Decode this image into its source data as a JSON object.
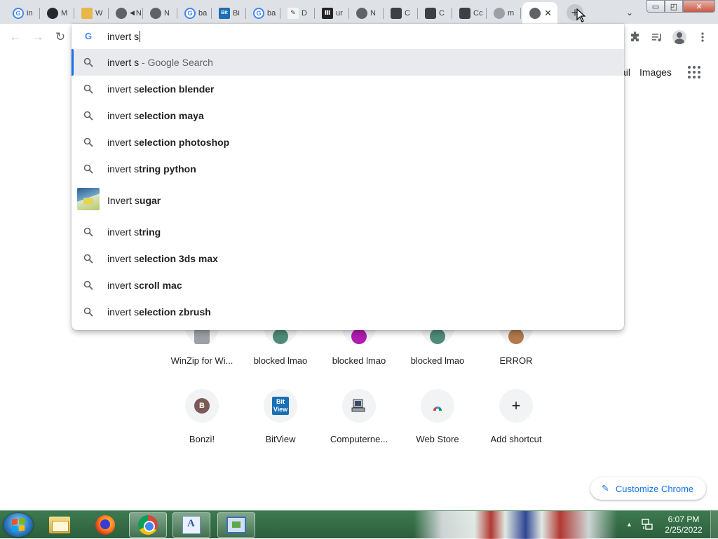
{
  "tabs": [
    {
      "favicon": "google-icon",
      "title": "in"
    },
    {
      "favicon": "github-icon",
      "title": "M"
    },
    {
      "favicon": "wiki-icon",
      "title": "W"
    },
    {
      "favicon": "speaker-icon",
      "title": "N"
    },
    {
      "favicon": "globe-icon",
      "title": "N"
    },
    {
      "favicon": "google-icon",
      "title": "ba"
    },
    {
      "favicon": "bitview-icon",
      "title": "Bi"
    },
    {
      "favicon": "google-icon",
      "title": "ba"
    },
    {
      "favicon": "deviantart-icon",
      "title": "D"
    },
    {
      "favicon": "library-icon",
      "title": "ur"
    },
    {
      "favicon": "globe-icon",
      "title": "N"
    },
    {
      "favicon": "cube-icon",
      "title": "C"
    },
    {
      "favicon": "cube-icon",
      "title": "C"
    },
    {
      "favicon": "cube-icon",
      "title": "Cc"
    },
    {
      "favicon": "globe-icon",
      "title": "m"
    },
    {
      "favicon": "chrome-icon",
      "title": ""
    }
  ],
  "active_tab_close": "✕",
  "new_tab_symbol": "+",
  "tab_search_symbol": "⌄",
  "window_controls": {
    "minimize": "▭",
    "maximize": "◰",
    "close": "✕"
  },
  "toolbar": {
    "back": "←",
    "forward": "→",
    "reload": "↻"
  },
  "omnibox": {
    "google_g": "G",
    "text": "invert s",
    "suggestions": [
      {
        "prefix": "invert s",
        "bold": "",
        "suffix": " - Google Search",
        "type": "search",
        "selected": true
      },
      {
        "prefix": "invert s",
        "bold": "election blender",
        "suffix": "",
        "type": "search"
      },
      {
        "prefix": "invert s",
        "bold": "election maya",
        "suffix": "",
        "type": "search"
      },
      {
        "prefix": "invert s",
        "bold": "election photoshop",
        "suffix": "",
        "type": "search"
      },
      {
        "prefix": "invert s",
        "bold": "tring python",
        "suffix": "",
        "type": "search"
      },
      {
        "prefix": "Invert s",
        "bold": "ugar",
        "suffix": "",
        "type": "entity"
      },
      {
        "prefix": "invert s",
        "bold": "tring",
        "suffix": "",
        "type": "search"
      },
      {
        "prefix": "invert s",
        "bold": "election 3ds max",
        "suffix": "",
        "type": "search"
      },
      {
        "prefix": "invert s",
        "bold": "croll mac",
        "suffix": "",
        "type": "search"
      },
      {
        "prefix": "invert s",
        "bold": "election zbrush",
        "suffix": "",
        "type": "search"
      }
    ]
  },
  "ntp": {
    "gmail_link": "Gmail",
    "images_link": "Images",
    "shortcuts_row1": [
      {
        "label": "WinZip for Wi...",
        "color": "#9aa0a6"
      },
      {
        "label": "blocked lmao",
        "color": "#4e8a78"
      },
      {
        "label": "blocked lmao",
        "color": "#b01bb0"
      },
      {
        "label": "blocked lmao",
        "color": "#4e8a78"
      },
      {
        "label": "ERROR",
        "color": "#b07a4a"
      }
    ],
    "shortcuts_row2": [
      {
        "label": "Bonzi!",
        "icon_text": "B",
        "color": "#7b5a55"
      },
      {
        "label": "BitView",
        "icon_text": "Bit View",
        "color": "#1a6fb5"
      },
      {
        "label": "Computerne...",
        "icon_text": "",
        "color": "#5f6368"
      },
      {
        "label": "Web Store",
        "icon_text": "",
        "color": "#db4437"
      },
      {
        "label": "Add shortcut",
        "icon_text": "+",
        "color": "#202124"
      }
    ],
    "customize_label": "Customize Chrome"
  },
  "taskbar": {
    "items": [
      "explorer-icon",
      "firefox-icon",
      "chrome-icon",
      "wordpad-icon",
      "remote-desktop-icon"
    ],
    "clock_time": "6:07 PM",
    "clock_date": "2/25/2022"
  }
}
